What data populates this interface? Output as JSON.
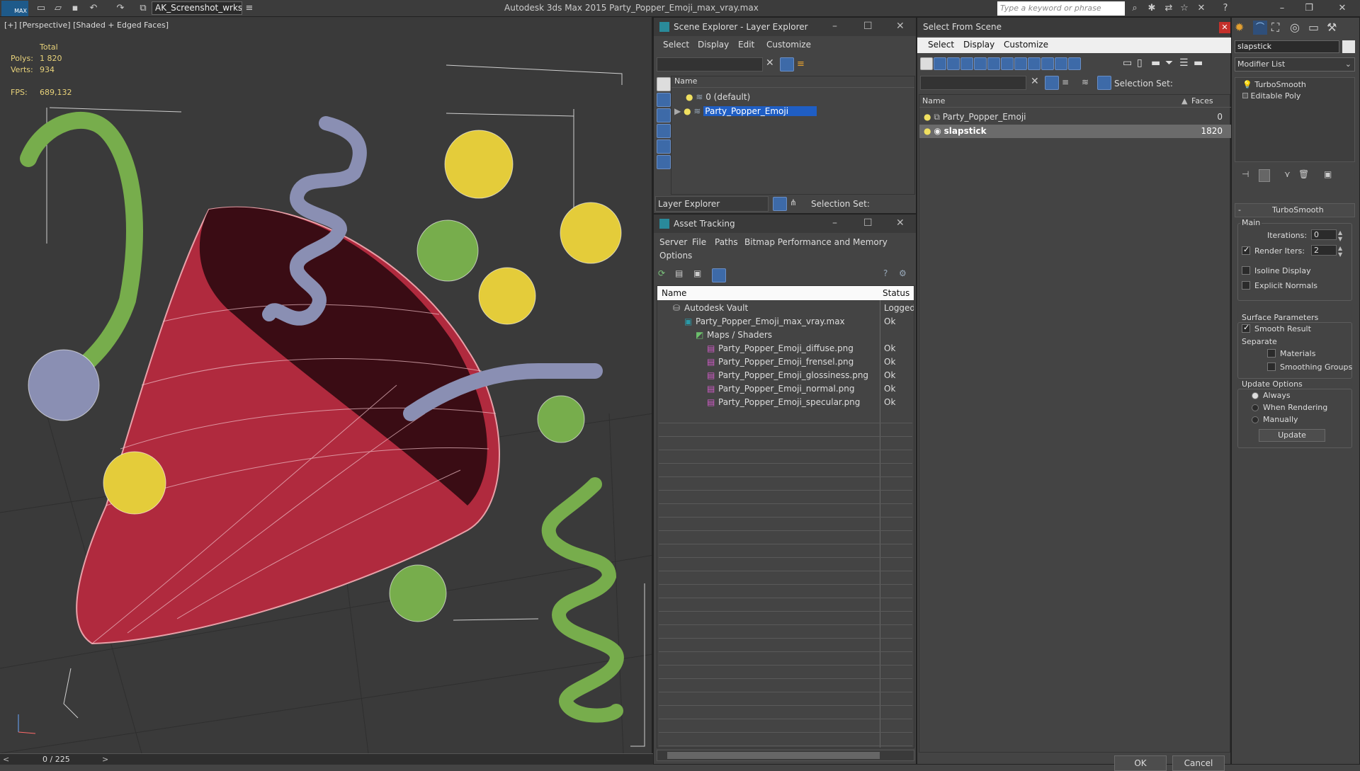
{
  "titlebar": {
    "logo": "MAX",
    "workspace": "AK_Screenshot_wrksp",
    "app_title": "Autodesk 3ds Max  2015    Party_Popper_Emoji_max_vray.max",
    "search_placeholder": "Type a keyword or phrase"
  },
  "viewport": {
    "label": "[+] [Perspective] [Shaded + Edged Faces]",
    "stats": {
      "total_label": "Total",
      "polys_label": "Polys:",
      "polys_value": "1 820",
      "verts_label": "Verts:",
      "verts_value": "934",
      "fps_label": "FPS:",
      "fps_value": "689,132"
    },
    "timeline": "0 / 225"
  },
  "scene_explorer": {
    "title": "Scene Explorer - Layer Explorer",
    "menu": [
      "Select",
      "Display",
      "Edit",
      "Customize"
    ],
    "column_name": "Name",
    "rows": [
      "0 (default)",
      "Party_Popper_Emoji"
    ],
    "footer_label": "Layer Explorer",
    "selection_set_label": "Selection Set:"
  },
  "asset_tracking": {
    "title": "Asset Tracking",
    "menu": [
      "Server",
      "File",
      "Paths",
      "Bitmap Performance and Memory",
      "Options"
    ],
    "col_name": "Name",
    "col_status": "Status",
    "rows": [
      {
        "name": "Autodesk Vault",
        "status": "Logged",
        "indent": 0,
        "icon": "vault-icon"
      },
      {
        "name": "Party_Popper_Emoji_max_vray.max",
        "status": "Ok",
        "indent": 1,
        "icon": "max-file-icon"
      },
      {
        "name": "Maps / Shaders",
        "status": "",
        "indent": 2,
        "icon": "maps-icon"
      },
      {
        "name": "Party_Popper_Emoji_diffuse.png",
        "status": "Ok",
        "indent": 3,
        "icon": "png-icon"
      },
      {
        "name": "Party_Popper_Emoji_frensel.png",
        "status": "Ok",
        "indent": 3,
        "icon": "png-icon"
      },
      {
        "name": "Party_Popper_Emoji_glossiness.png",
        "status": "Ok",
        "indent": 3,
        "icon": "png-icon"
      },
      {
        "name": "Party_Popper_Emoji_normal.png",
        "status": "Ok",
        "indent": 3,
        "icon": "png-icon"
      },
      {
        "name": "Party_Popper_Emoji_specular.png",
        "status": "Ok",
        "indent": 3,
        "icon": "png-icon"
      }
    ]
  },
  "select_from_scene": {
    "title": "Select From Scene",
    "menu": [
      "Select",
      "Display",
      "Customize"
    ],
    "selection_set_label": "Selection Set:",
    "col_name": "Name",
    "col_faces": "Faces",
    "rows": [
      {
        "name": "Party_Popper_Emoji",
        "faces": "0"
      },
      {
        "name": "slapstick",
        "faces": "1820"
      }
    ],
    "ok_label": "OK",
    "cancel_label": "Cancel"
  },
  "modify_panel": {
    "object_name": "slapstick",
    "modifier_list_label": "Modifier List",
    "stack": [
      "TurboSmooth",
      "Editable Poly"
    ],
    "rollout_title": "TurboSmooth",
    "main_label": "Main",
    "iterations_label": "Iterations:",
    "iterations_value": "0",
    "render_iters_label": "Render Iters:",
    "render_iters_value": "2",
    "isoline_label": "Isoline Display",
    "explicit_normals_label": "Explicit Normals",
    "surface_params_label": "Surface Parameters",
    "smooth_result_label": "Smooth Result",
    "separate_label": "Separate",
    "materials_label": "Materials",
    "smoothing_groups_label": "Smoothing Groups",
    "update_options_label": "Update Options",
    "always_label": "Always",
    "when_rendering_label": "When Rendering",
    "manually_label": "Manually",
    "update_button": "Update"
  },
  "colors": {
    "selection_blue": "#1f5ec4",
    "popper_red": "#b8283e",
    "ball_green": "#77ad4c",
    "ball_yellow": "#e4cc3a",
    "ball_lavender": "#8a8fb3",
    "stat_yellow": "#e8d27a"
  }
}
